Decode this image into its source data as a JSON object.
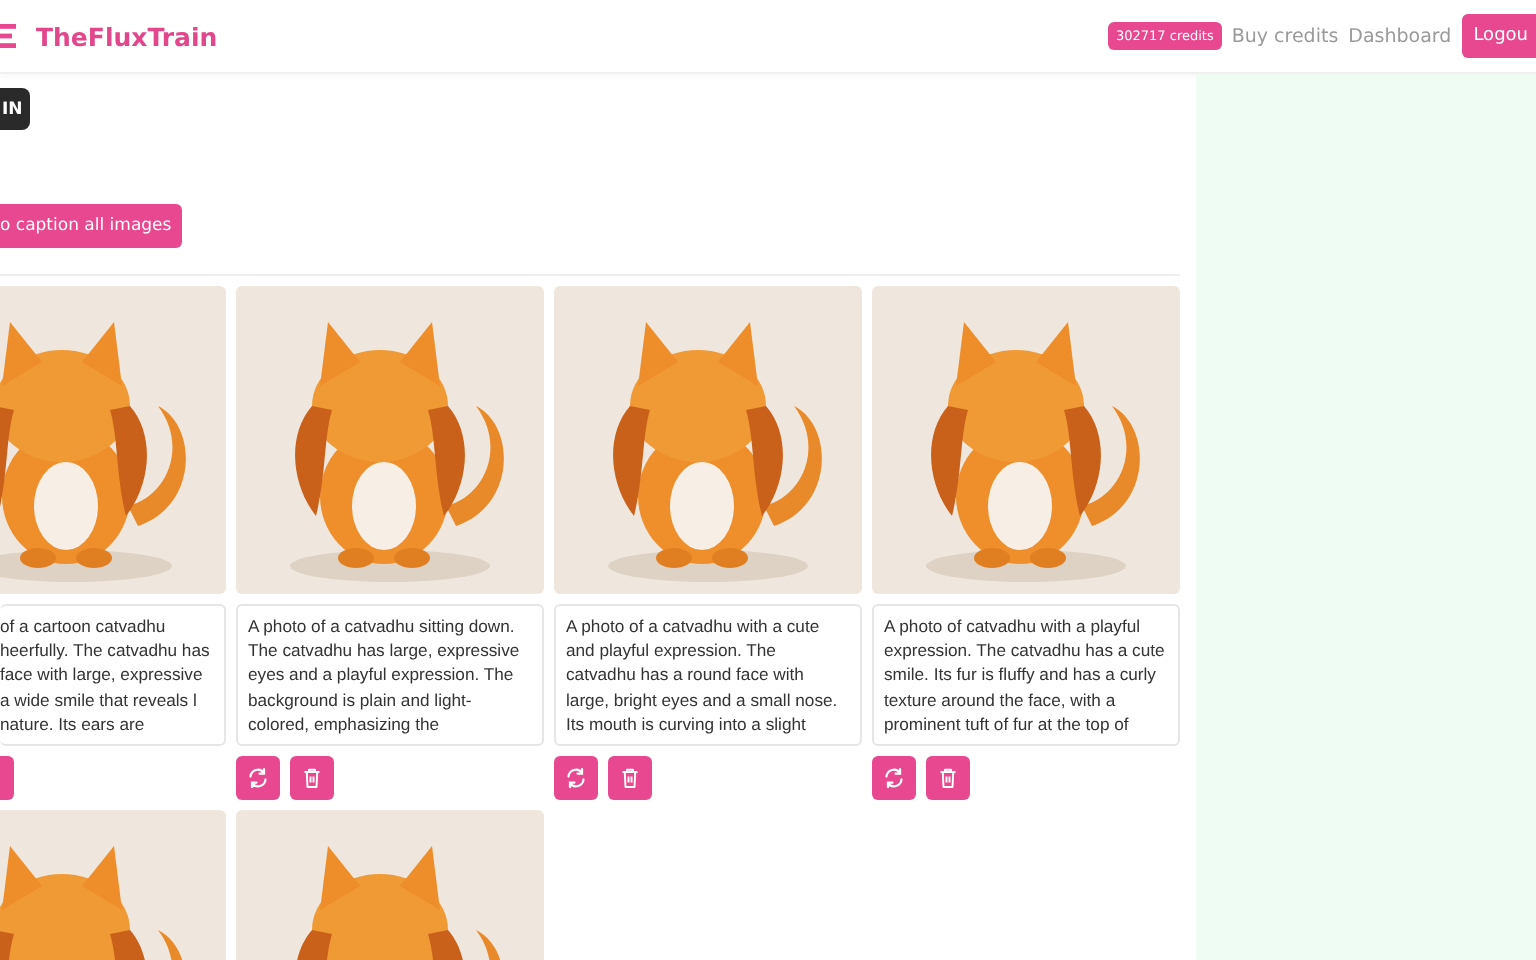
{
  "header": {
    "brand": "TheFluxTrain",
    "credits": "302717 credits",
    "links": [
      "Buy credits",
      "Dashboard"
    ],
    "logout": "Logou"
  },
  "train_button": "IN",
  "caption_all_button": "o caption all images",
  "images": [
    {
      "kind": "picture",
      "caption": "of a cartoon catvadhu heerfully. The catvadhu has face with large, expressive a wide smile that reveals l nature. Its ears are",
      "cut": true
    },
    {
      "kind": "picture",
      "caption": "A photo of a catvadhu sitting down. The catvadhu has large, expressive eyes and a playful expression. The background is plain and light-colored, emphasizing the",
      "cut": false
    },
    {
      "kind": "picture",
      "caption": "A photo of a catvadhu with a cute and playful expression. The catvadhu has a round face with large, bright eyes and a small nose. Its mouth is curving into a slight",
      "cut": false
    },
    {
      "kind": "picture",
      "caption": "A photo of catvadhu with a playful expression. The catvadhu has a cute smile. Its fur is fluffy and has a curly texture around the face, with a prominent tuft of fur at the top of",
      "cut": false
    },
    {
      "kind": "picture",
      "cut": true
    },
    {
      "kind": "picture",
      "cut": false
    }
  ]
}
